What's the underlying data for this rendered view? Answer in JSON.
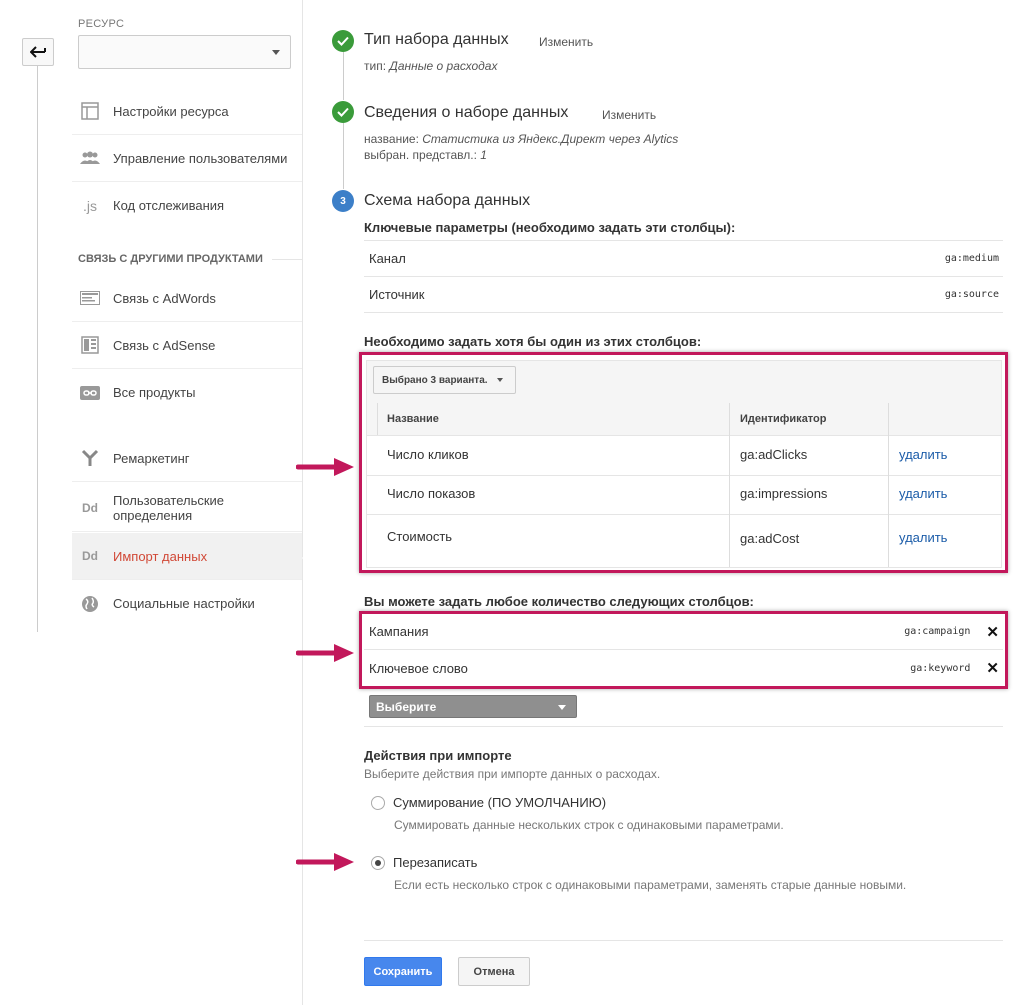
{
  "sidebar": {
    "resource_label": "РЕСУРС",
    "resource_value": "",
    "items_top": [
      {
        "label": "Настройки ресурса",
        "icon": "layout-icon"
      },
      {
        "label": "Управление пользователями",
        "icon": "users-icon"
      },
      {
        "label": "Код отслеживания",
        "icon": "js-icon",
        "icon_text": ".js"
      }
    ],
    "section_title": "СВЯЗЬ С ДРУГИМИ ПРОДУКТАМИ",
    "items_links": [
      {
        "label": "Связь с AdWords",
        "icon": "adwords-icon"
      },
      {
        "label": "Связь с AdSense",
        "icon": "adsense-icon"
      },
      {
        "label": "Все продукты",
        "icon": "link-icon"
      }
    ],
    "items_bottom": [
      {
        "label": "Ремаркетинг",
        "icon": "remarketing-icon"
      },
      {
        "label": "Пользовательские определения",
        "line1": "Пользовательские",
        "line2": "определения",
        "icon": "dd-icon",
        "icon_text": "Dd"
      },
      {
        "label": "Импорт данных",
        "icon": "dd-icon",
        "icon_text": "Dd",
        "active": true
      },
      {
        "label": "Социальные настройки",
        "icon": "globe-icon"
      }
    ]
  },
  "steps": {
    "step1": {
      "title": "Тип набора данных",
      "edit": "Изменить",
      "meta_label": "тип:",
      "meta_value": "Данные о расходах"
    },
    "step2": {
      "title": "Сведения о наборе данных",
      "edit": "Изменить",
      "name_label": "название:",
      "name_value": "Статистика из Яндекс.Директ через Alytics",
      "view_label": "выбран. представл.:",
      "view_value": "1"
    },
    "step3": {
      "number": "3",
      "title": "Схема набора данных"
    }
  },
  "key_params": {
    "heading": "Ключевые параметры (необходимо задать эти столбцы):",
    "rows": [
      {
        "name": "Канал",
        "id": "ga:medium"
      },
      {
        "name": "Источник",
        "id": "ga:source"
      }
    ]
  },
  "required_one": {
    "heading": "Необходимо задать хотя бы один из этих столбцов:",
    "dropdown": "Выбрано 3 варианта.",
    "col_name": "Название",
    "col_id": "Идентификатор",
    "rows": [
      {
        "name": "Число кликов",
        "id": "ga:adClicks",
        "action": "удалить"
      },
      {
        "name": "Число показов",
        "id": "ga:impressions",
        "action": "удалить"
      },
      {
        "name": "Стоимость",
        "id": "ga:adCost",
        "action": "удалить"
      }
    ]
  },
  "optional": {
    "heading": "Вы можете задать любое количество следующих столбцов:",
    "rows": [
      {
        "name": "Кампания",
        "id": "ga:campaign"
      },
      {
        "name": "Ключевое слово",
        "id": "ga:keyword"
      }
    ],
    "select": "Выберите"
  },
  "import_actions": {
    "heading": "Действия при импорте",
    "subheading": "Выберите действия при импорте данных о расходах.",
    "options": [
      {
        "label": "Суммирование (ПО УМОЛЧАНИЮ)",
        "desc": "Суммировать данные нескольких строк с одинаковыми параметрами.",
        "checked": false
      },
      {
        "label": "Перезаписать",
        "desc": "Если есть несколько строк с одинаковыми параметрами, заменять старые данные новыми.",
        "checked": true
      }
    ]
  },
  "buttons": {
    "save": "Сохранить",
    "cancel": "Отмена"
  },
  "colors": {
    "highlight": "#c2185b",
    "link": "#1a5ba8",
    "active_nav": "#d14836",
    "primary": "#4787ed",
    "done": "#3a9b3a",
    "current": "#3c7fc8"
  }
}
